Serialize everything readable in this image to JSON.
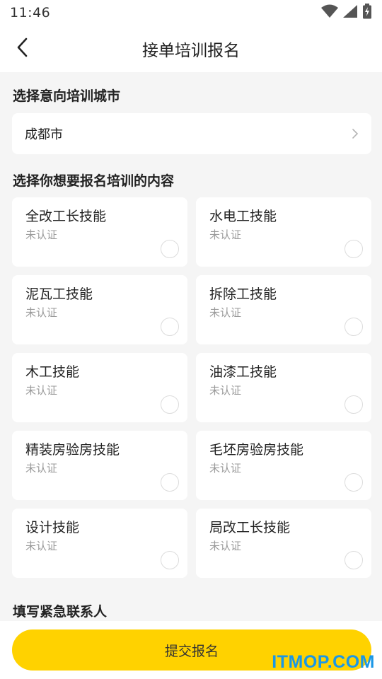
{
  "status_bar": {
    "time": "11:46",
    "icons": [
      "wifi-icon",
      "signal-icon",
      "battery-charging-icon"
    ]
  },
  "header": {
    "back_icon": "chevron-left-icon",
    "title": "接单培训报名"
  },
  "city_section": {
    "title": "选择意向培训城市",
    "value": "成都市",
    "chevron_icon": "chevron-right-icon"
  },
  "skills_section": {
    "title": "选择你想要报名培训的内容",
    "items": [
      {
        "name": "全改工长技能",
        "status": "未认证"
      },
      {
        "name": "水电工技能",
        "status": "未认证"
      },
      {
        "name": "泥瓦工技能",
        "status": "未认证"
      },
      {
        "name": "拆除工技能",
        "status": "未认证"
      },
      {
        "name": "木工技能",
        "status": "未认证"
      },
      {
        "name": "油漆工技能",
        "status": "未认证"
      },
      {
        "name": "精装房验房技能",
        "status": "未认证"
      },
      {
        "name": "毛坯房验房技能",
        "status": "未认证"
      },
      {
        "name": "设计技能",
        "status": "未认证"
      },
      {
        "name": "局改工长技能",
        "status": "未认证"
      }
    ]
  },
  "contact_section": {
    "title": "填写紧急联系人"
  },
  "submit": {
    "label": "提交报名"
  },
  "watermark": "ITMOP.COM",
  "colors": {
    "accent": "#ffd200",
    "background": "#f5f5f5",
    "card": "#ffffff",
    "muted_text": "#9a9a9a",
    "watermark": "#1a97e6"
  }
}
